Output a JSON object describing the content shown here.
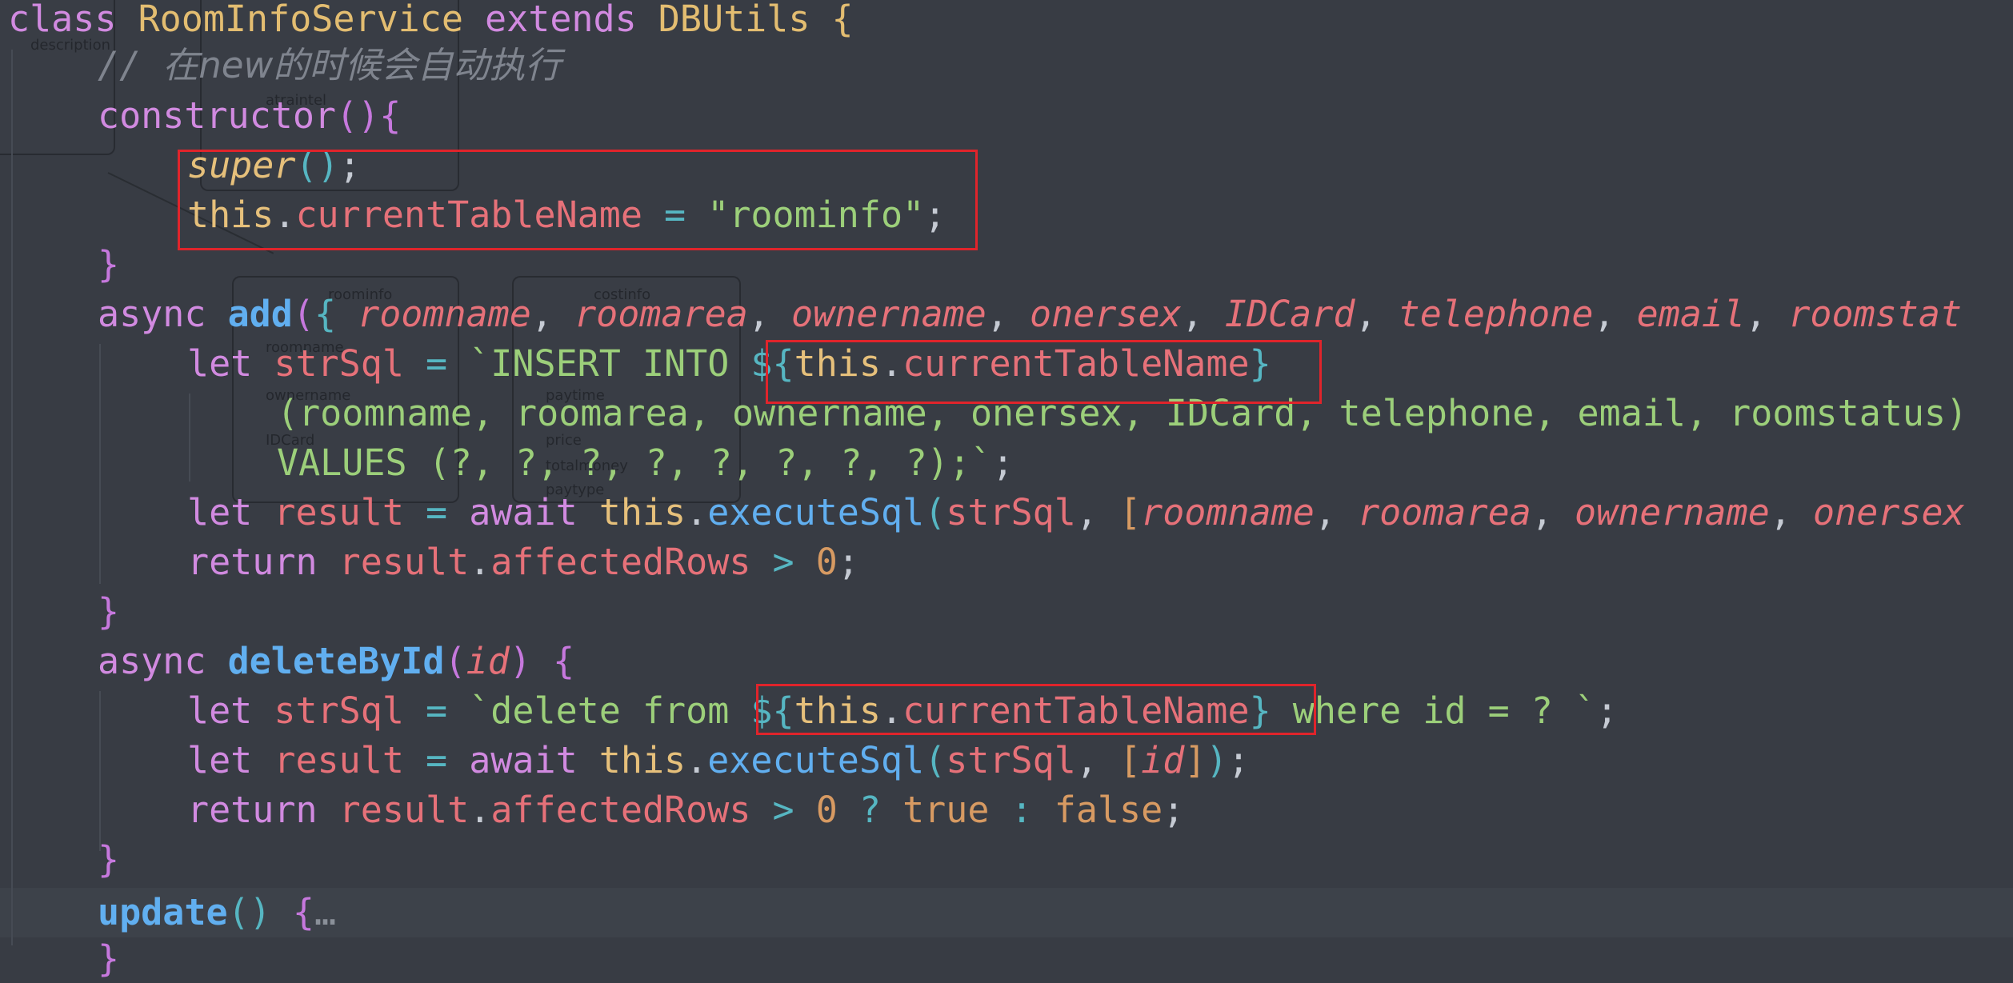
{
  "editor": {
    "language": "javascript",
    "lines": [
      {
        "id": "l1",
        "text": "class RoomInfoService extends DBUtils {"
      },
      {
        "id": "l2",
        "text": "    // 在new的时候会自动执行"
      },
      {
        "id": "l3",
        "text": "    constructor(){"
      },
      {
        "id": "l4",
        "text": "        super();"
      },
      {
        "id": "l5",
        "text": "        this.currentTableName = \"roominfo\";"
      },
      {
        "id": "l6",
        "text": "    }"
      },
      {
        "id": "l7",
        "text": "    async add({ roomname, roomarea, ownername, onersex, IDCard, telephone, email, roomstat"
      },
      {
        "id": "l8",
        "text": "        let strSql = `INSERT INTO ${this.currentTableName}"
      },
      {
        "id": "l9",
        "text": "            (roomname, roomarea, ownername, onersex, IDCard, telephone, email, roomstatus)"
      },
      {
        "id": "l10",
        "text": "            VALUES (?, ?, ?, ?, ?, ?, ?, ?);`;"
      },
      {
        "id": "l11",
        "text": "        let result = await this.executeSql(strSql, [roomname, roomarea, ownername, onersex"
      },
      {
        "id": "l12",
        "text": "        return result.affectedRows > 0;"
      },
      {
        "id": "l13",
        "text": "    }"
      },
      {
        "id": "l14",
        "text": "    async deleteById(id) {"
      },
      {
        "id": "l15",
        "text": "        let strSql = `delete from ${this.currentTableName} where id = ? `;"
      },
      {
        "id": "l16",
        "text": "        let result = await this.executeSql(strSql, [id]);"
      },
      {
        "id": "l17",
        "text": "        return result.affectedRows > 0 ? true : false;"
      },
      {
        "id": "l18",
        "text": "    }"
      },
      {
        "id": "l19",
        "text": "    update() {…"
      },
      {
        "id": "l20",
        "text": "    }"
      }
    ],
    "highlighted_line": 19,
    "annotations": [
      {
        "label": "constructor-body-box",
        "color": "#e0242b"
      },
      {
        "label": "insert-table-name-box",
        "color": "#e0242b"
      },
      {
        "label": "delete-table-name-box",
        "color": "#e0242b"
      }
    ]
  },
  "background_diagram": {
    "labels": [
      "description",
      "atraintel",
      "roominfo",
      "costinfo",
      "roomname",
      "ownername",
      "IDCard",
      "paytime",
      "price",
      "totalmoney",
      "paytype"
    ]
  },
  "colors": {
    "background": "#383c44",
    "keyword": "#d18ae0",
    "class_name": "#e3bd71",
    "function": "#61aff0",
    "property": "#e67179",
    "string": "#9ccf7a",
    "number": "#d79a62",
    "comment": "#7f848e",
    "annotation_box": "#e0242b"
  }
}
